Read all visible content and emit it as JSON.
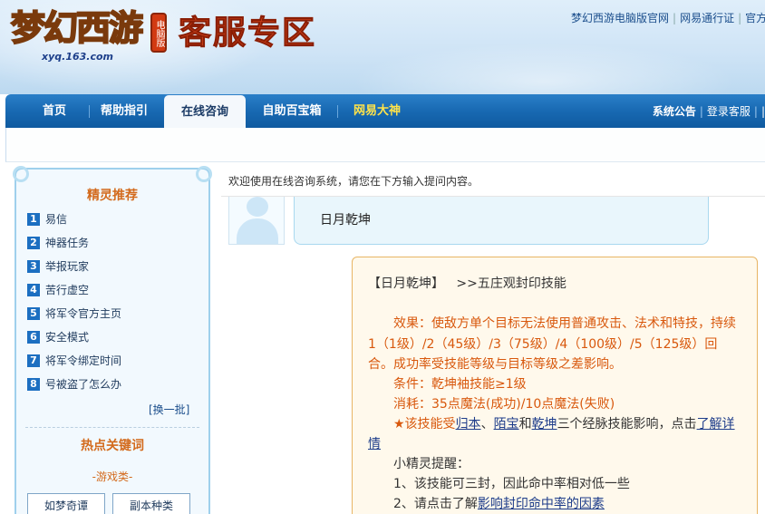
{
  "header": {
    "logo_text": "梦幻西游",
    "logo_badge": "电脑版",
    "logo_url": "xyq.163.com",
    "zone_title": "客服专区",
    "top_links": [
      "梦幻西游电脑版官网",
      "网易通行证",
      "官方"
    ]
  },
  "nav": {
    "tabs": [
      "首页",
      "帮助指引",
      "在线咨询",
      "自助百宝箱",
      "网易大神"
    ],
    "active_tab": "在线咨询",
    "right_links": [
      "系统公告",
      "登录客服",
      "|"
    ]
  },
  "sidebar": {
    "recommend_title": "精灵推荐",
    "items": [
      {
        "num": "1",
        "label": "易信"
      },
      {
        "num": "2",
        "label": "神器任务"
      },
      {
        "num": "3",
        "label": "举报玩家"
      },
      {
        "num": "4",
        "label": "苦行虚空"
      },
      {
        "num": "5",
        "label": "将军令官方主页"
      },
      {
        "num": "6",
        "label": "安全模式"
      },
      {
        "num": "7",
        "label": "将军令绑定时间"
      },
      {
        "num": "8",
        "label": "号被盗了怎么办"
      }
    ],
    "refresh_label": "[换一批]",
    "hot_title": "热点关键词",
    "category_label": "-游戏类-",
    "keyword_buttons": [
      "如梦奇谭",
      "副本种类"
    ]
  },
  "main": {
    "welcome_text": "欢迎使用在线咨询系统，请您在下方输入提问内容。",
    "user_question": "日月乾坤",
    "answer": {
      "heading_term": "【日月乾坤】",
      "heading_path": ">>五庄观封印技能",
      "effect_line1": "效果：使敌方单个目标无法使用普通攻击、法术和特技，持续",
      "effect_line2": "1（1级）/2（45级）/3（75级）/4（100级）/5（125级）回",
      "effect_line3": "合。成功率受技能等级与目标等级之差影响。",
      "condition": "条件：乾坤袖技能≥1级",
      "cost": "消耗：35点魔法(成功)/10点魔法(失败)",
      "star_prefix": "★该技能受",
      "link_guiben": "归本",
      "sep1": "、",
      "link_moubao": "陌宝",
      "and": "和",
      "link_qiankun": "乾坤",
      "star_suffix": "三个经脉技能影响，点击",
      "link_detail_1": "了解详",
      "link_detail_2": "情",
      "tip_title": "小精灵提醒：",
      "tip1": "1、该技能可三封，因此命中率相对低一些",
      "tip2_prefix": "2、请点击了解",
      "tip2_link": "影响封印命中率的因素"
    }
  },
  "colors": {
    "nav_blue": "#1869b2",
    "accent_orange": "#d8580d",
    "link_blue": "#1d3c8a",
    "answer_border": "#e8b564"
  }
}
